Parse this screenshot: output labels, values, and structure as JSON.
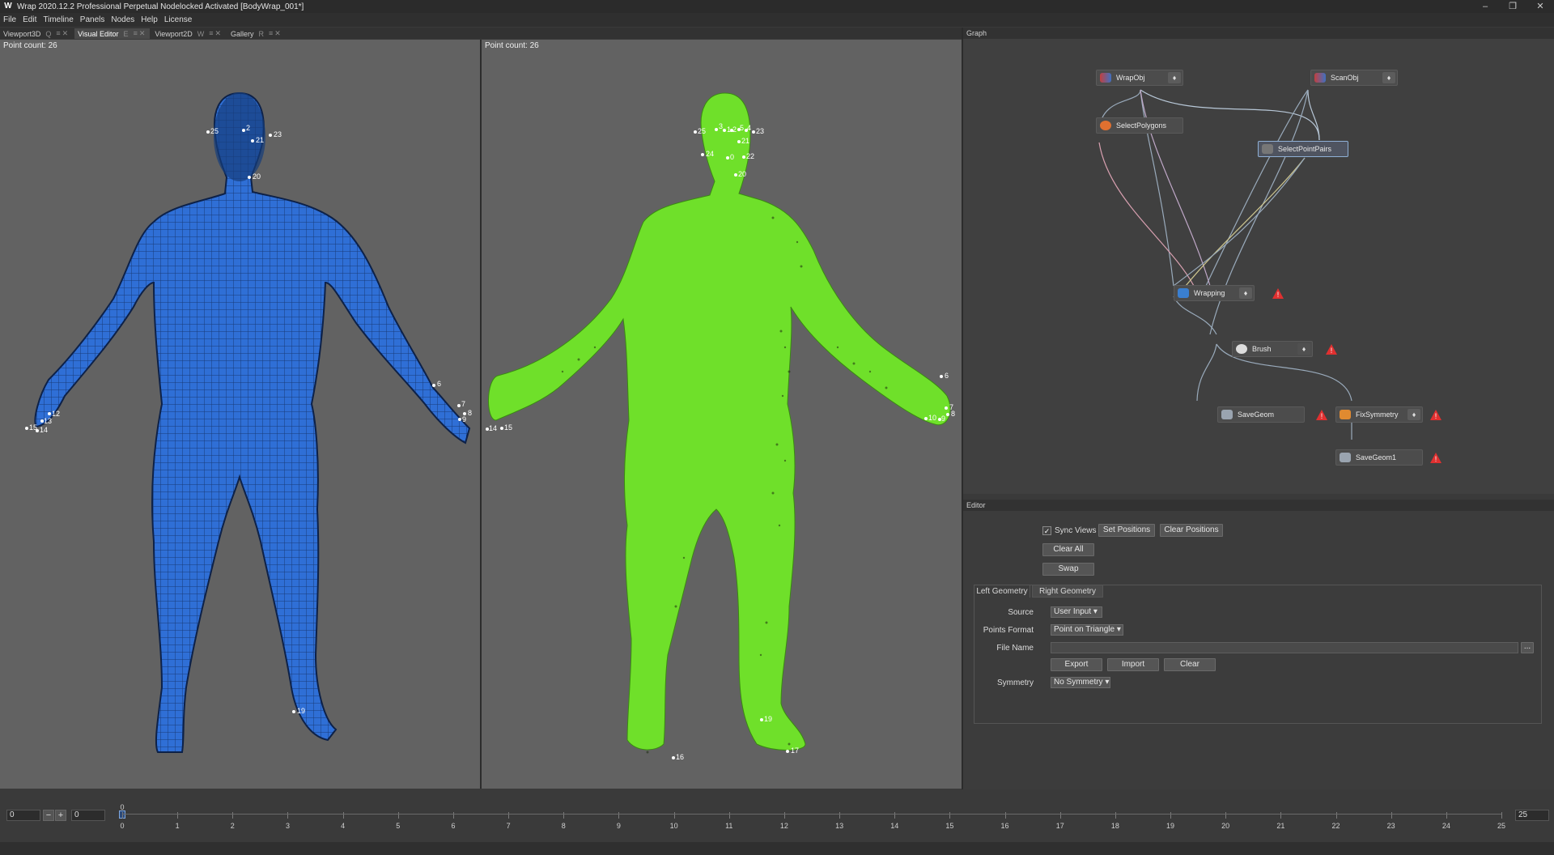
{
  "window": {
    "title": "Wrap 2020.12.2 Professional Perpetual Nodelocked Activated  [BodyWrap_001*]",
    "logo": "W"
  },
  "menu": [
    "File",
    "Edit",
    "Timeline",
    "Panels",
    "Nodes",
    "Help",
    "License"
  ],
  "tabs": [
    {
      "label": "Viewport3D",
      "shortcut": "Q"
    },
    {
      "label": "Visual Editor",
      "shortcut": "E"
    },
    {
      "label": "Viewport2D",
      "shortcut": "W"
    },
    {
      "label": "Gallery",
      "shortcut": "R"
    }
  ],
  "viewports": {
    "left": {
      "point_count": "Point count: 26",
      "markers": [
        "25",
        "2",
        "21",
        "23",
        "20",
        "6",
        "7",
        "8",
        "9",
        "12",
        "13",
        "15",
        "14",
        "19"
      ]
    },
    "right": {
      "point_count": "Point count: 26",
      "markers": [
        "25",
        "3",
        "1",
        "2",
        "5",
        "4",
        "23",
        "21",
        "24",
        "0",
        "22",
        "20",
        "6",
        "7",
        "8",
        "10",
        "9",
        "14",
        "15",
        "19",
        "16",
        "17"
      ]
    }
  },
  "graph": {
    "title": "Graph",
    "nodes": {
      "wrapobj": "WrapObj",
      "scanobj": "ScanObj",
      "selectpolygons": "SelectPolygons",
      "selectpointpairs": "SelectPointPairs",
      "wrapping": "Wrapping",
      "brush": "Brush",
      "savegeom": "SaveGeom",
      "fixsymmetry": "FixSymmetry",
      "savegeom1": "SaveGeom1"
    }
  },
  "editor": {
    "title": "Editor",
    "sync_views": "Sync Views",
    "set_positions": "Set Positions",
    "clear_positions": "Clear Positions",
    "clear_all": "Clear All",
    "swap": "Swap",
    "tab_left": "Left Geometry",
    "tab_right": "Right Geometry",
    "source_label": "Source",
    "source_value": "User Input",
    "points_format_label": "Points Format",
    "points_format_value": "Point on Triangle",
    "file_name_label": "File Name",
    "file_name_value": "",
    "browse": "...",
    "export": "Export",
    "import": "Import",
    "clear": "Clear",
    "symmetry_label": "Symmetry",
    "symmetry_value": "No Symmetry"
  },
  "timeline": {
    "start": "0",
    "current": "0",
    "end": "25",
    "marker": "0",
    "ticks": [
      "0",
      "1",
      "2",
      "3",
      "4",
      "5",
      "6",
      "7",
      "8",
      "9",
      "10",
      "11",
      "12",
      "13",
      "14",
      "15",
      "16",
      "17",
      "18",
      "19",
      "20",
      "21",
      "22",
      "23",
      "24",
      "25"
    ]
  },
  "colors": {
    "mesh_blue": "#2f6fd6",
    "scan_green": "#6fe02a",
    "warning_red": "#e03030",
    "selected_node": "#8fb0d6"
  }
}
